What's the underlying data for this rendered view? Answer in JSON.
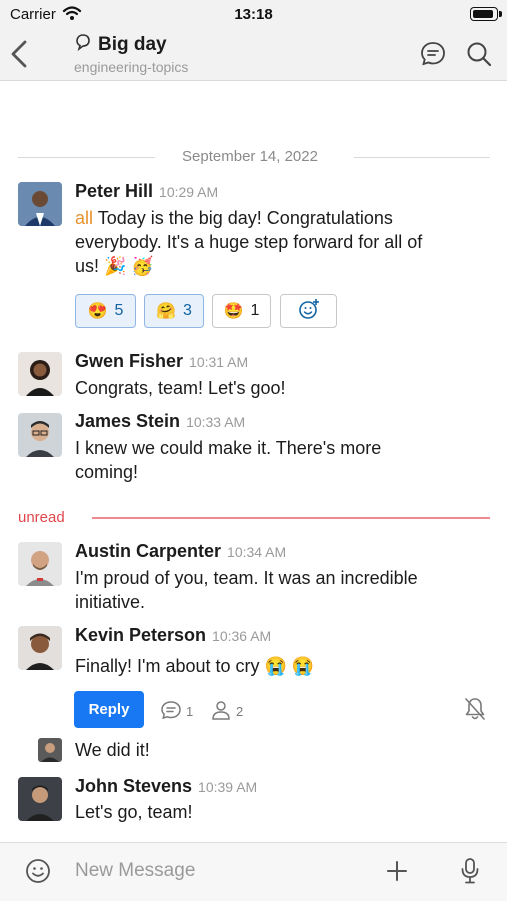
{
  "status_bar": {
    "carrier": "Carrier",
    "time": "13:18"
  },
  "header": {
    "title": "Big day",
    "subtitle": "engineering-topics"
  },
  "date_separator": "September 14, 2022",
  "messages": [
    {
      "author": "Peter Hill",
      "time": "10:29 AM",
      "mention": "all",
      "lines": [
        "Today is the big day! Congratulations",
        "everybody. It's a huge step forward for all of",
        "us! 🎉 🥳"
      ],
      "reactions": [
        {
          "emoji": "😍",
          "count": "5"
        },
        {
          "emoji": "🤗",
          "count": "3"
        },
        {
          "emoji": "🤩",
          "count": "1"
        }
      ]
    },
    {
      "author": "Gwen Fisher",
      "time": "10:31 AM",
      "lines": [
        "Congrats, team! Let's goo!"
      ]
    },
    {
      "author": "James Stein",
      "time": "10:33 AM",
      "lines": [
        "I knew we could make it. There's more",
        "coming!"
      ]
    },
    {
      "author": "Austin Carpenter",
      "time": "10:34 AM",
      "lines": [
        "I'm proud of you, team. It was an incredible",
        "initiative."
      ]
    },
    {
      "author": "Kevin Peterson",
      "time": "10:36 AM",
      "lines": [
        "Finally! I'm about to cry 😭 😭"
      ],
      "reply_label": "Reply",
      "reply_count": "1",
      "participant_count": "2"
    },
    {
      "author": "",
      "time": "",
      "lines": [
        "We did it!"
      ]
    },
    {
      "author": "John Stevens",
      "time": "10:39 AM",
      "lines": [
        "Let's go, team!"
      ]
    }
  ],
  "unread_label": "unread",
  "compose": {
    "placeholder": "New Message"
  },
  "colors": {
    "accent": "#1877f2",
    "mention": "#e8912d",
    "unread": "#e0474c"
  },
  "icons": [
    "wifi-icon",
    "battery-icon",
    "back-chevron-icon",
    "channel-icon",
    "thread-icon",
    "search-icon",
    "add-reaction-icon",
    "thread-replies-icon",
    "participants-icon",
    "mute-bell-icon",
    "emoji-icon",
    "plus-icon",
    "microphone-icon"
  ]
}
